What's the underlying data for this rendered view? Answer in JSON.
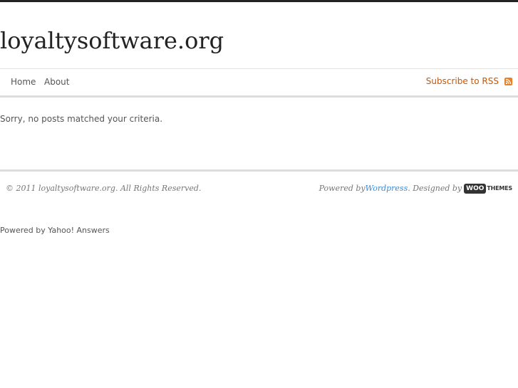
{
  "header": {
    "site_title": "loyaltysoftware.org"
  },
  "nav": {
    "items": [
      {
        "label": "Home"
      },
      {
        "label": "About"
      }
    ],
    "rss_label": "Subscribe to RSS",
    "rss_icon": "rss-icon",
    "rss_color": "#cc5500"
  },
  "main": {
    "message": "Sorry, no posts matched your criteria."
  },
  "footer": {
    "copyright": "© 2011 loyaltysoftware.org. All Rights Reserved.",
    "powered_prefix": "Powered by ",
    "powered_link": "Wordpress",
    "designed_by": ". Designed by ",
    "logo_woo": "WOO",
    "logo_themes": "THEMES",
    "link_color": "#3a8ad4"
  },
  "extra": {
    "powered_yahoo": "Powered by Yahoo! Answers"
  }
}
